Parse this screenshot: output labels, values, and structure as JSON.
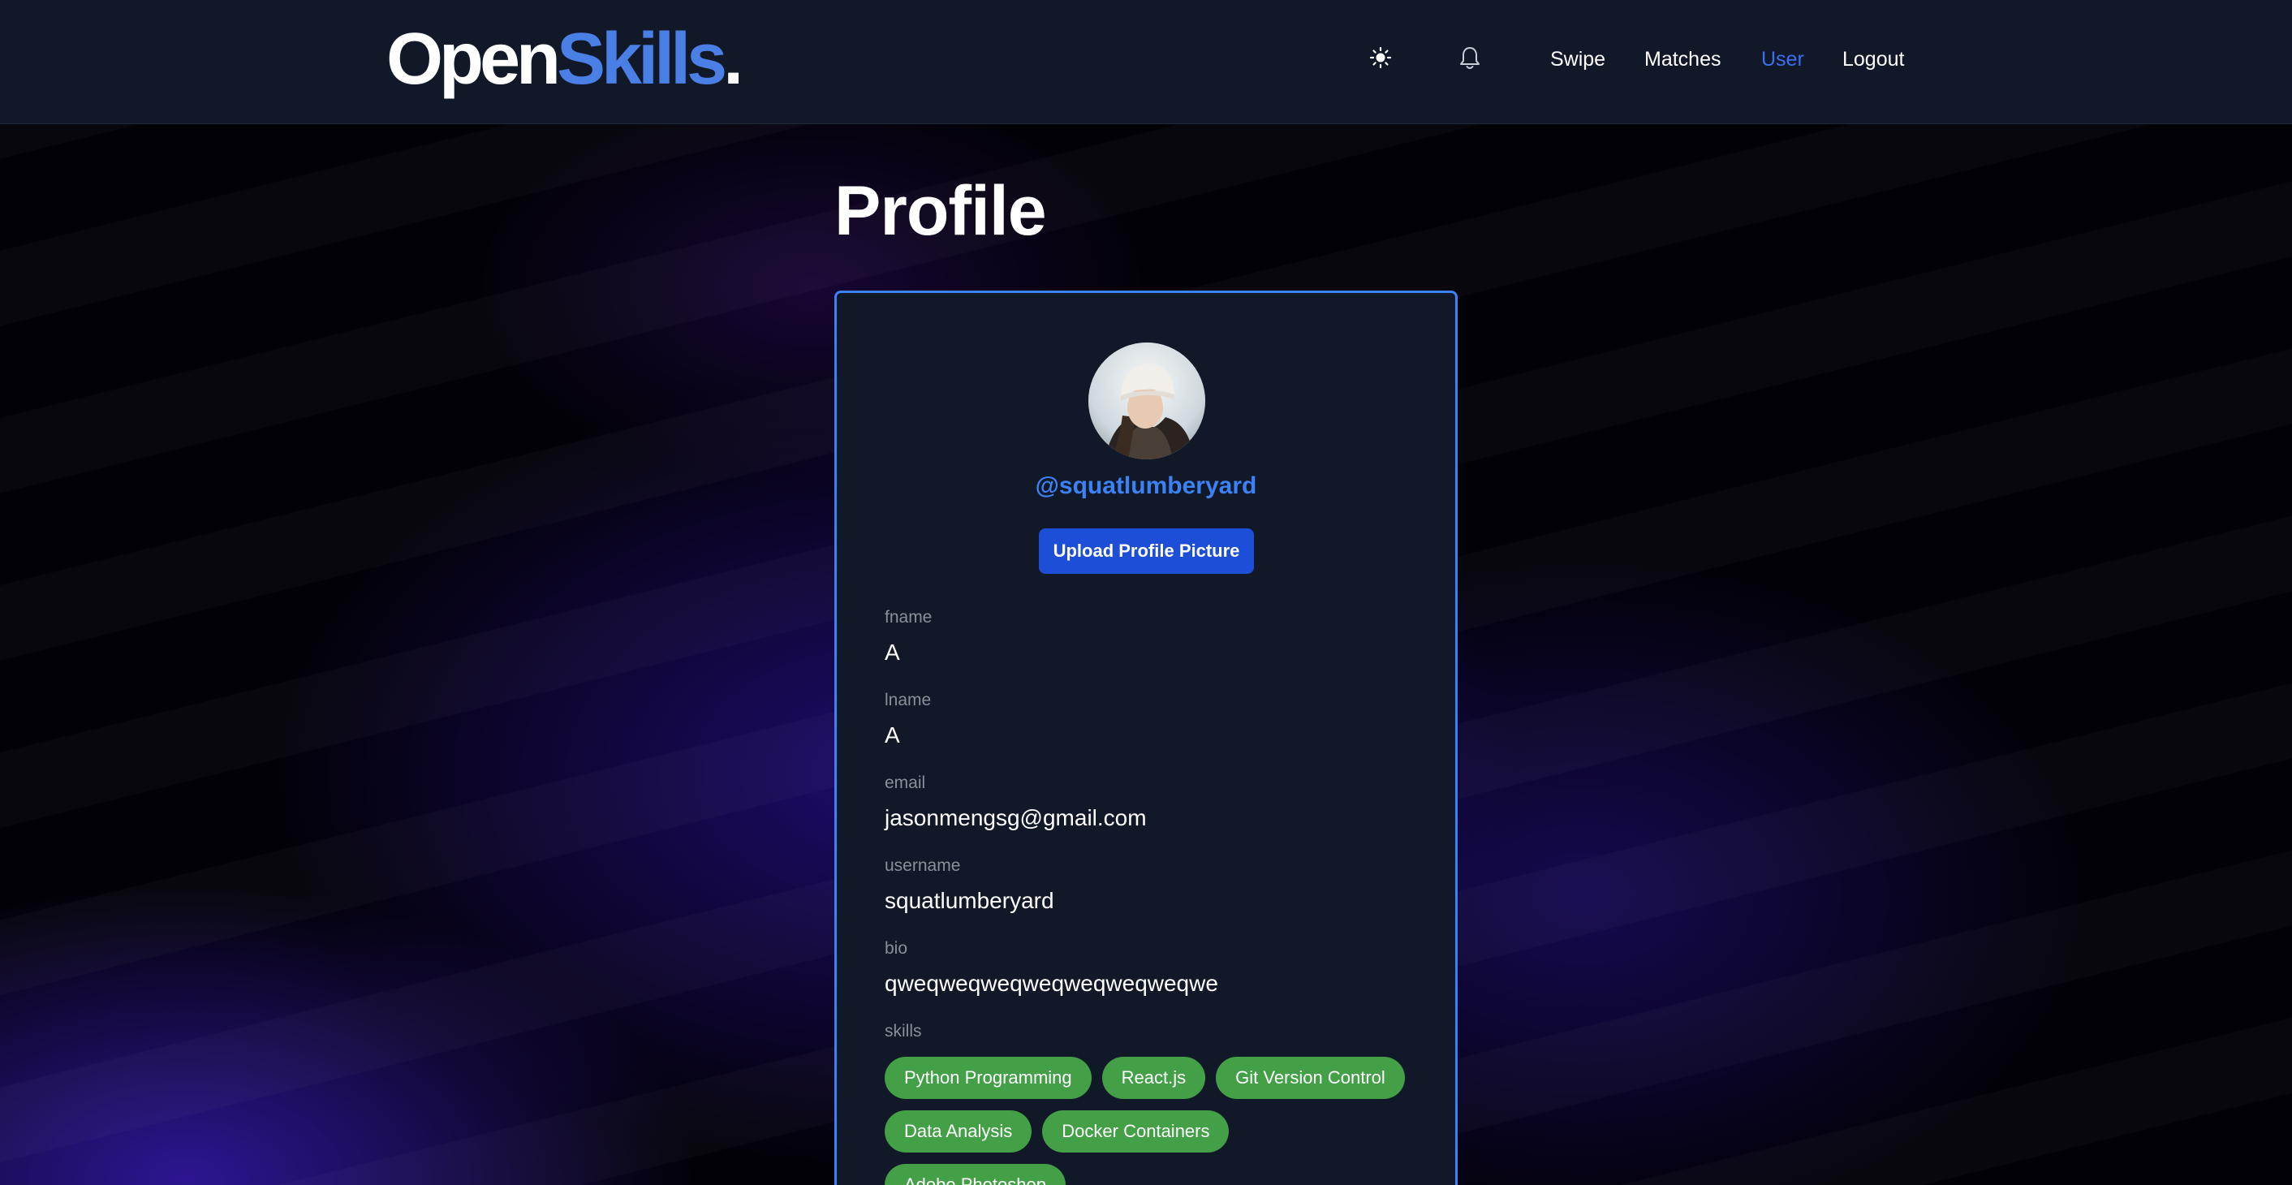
{
  "header": {
    "logo_part1": "Open",
    "logo_part2": "Skills",
    "logo_dot": ".",
    "theme_icon": "sun-icon",
    "notifications_icon": "bell-icon",
    "nav": {
      "swipe": "Swipe",
      "matches": "Matches",
      "user": "User",
      "logout": "Logout"
    },
    "active_color": "#3b6ef0"
  },
  "page_title": "Profile",
  "profile": {
    "handle": "@squatlumberyard",
    "upload_button": "Upload Profile Picture",
    "fields": [
      {
        "label": "fname",
        "value": "A"
      },
      {
        "label": "lname",
        "value": "A"
      },
      {
        "label": "email",
        "value": "jasonmengsg@gmail.com"
      },
      {
        "label": "username",
        "value": "squatlumberyard"
      },
      {
        "label": "bio",
        "value": "qweqweqweqweqweqweqweqwe"
      }
    ],
    "skills_label": "skills",
    "skills": [
      "Python Programming",
      "React.js",
      "Git Version Control",
      "Data Analysis",
      "Docker Containers",
      "Adobe Photoshop"
    ],
    "skill_color": "#43a047",
    "accent_color": "#3b82f6"
  }
}
